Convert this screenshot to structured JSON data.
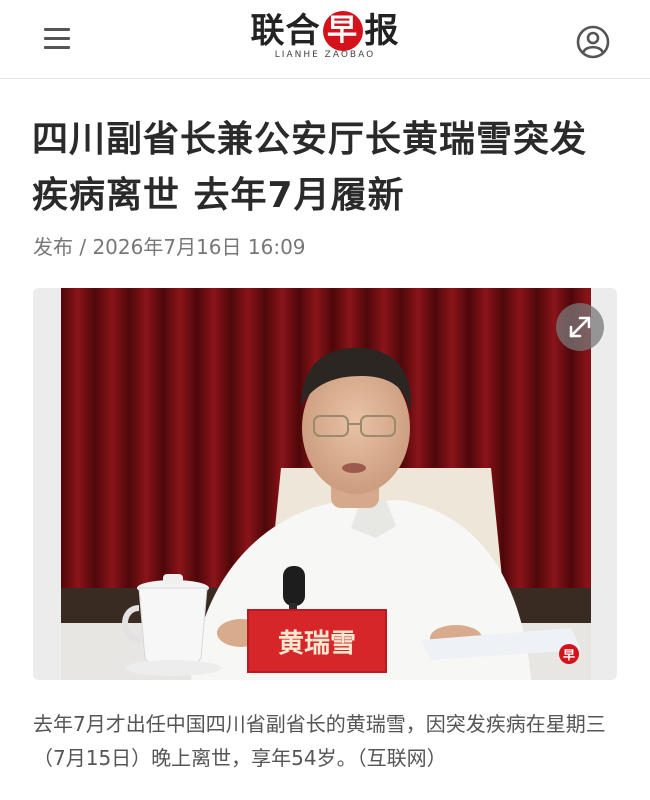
{
  "header": {
    "logo_cn_1": "联合",
    "logo_cn_2": "早",
    "logo_cn_3": "报",
    "logo_en": "LIANHE ZAOBAO",
    "menu_icon": "hamburger-menu-icon",
    "account_icon": "user-account-icon"
  },
  "article": {
    "title": "四川副省长兼公安厅长黄瑞雪突发疾病离世 去年7月履新",
    "published": "发布 / 2026年7月16日 16:09",
    "image": {
      "nameplate": "黄瑞雪",
      "watermark": "早",
      "expand_icon": "expand-icon"
    },
    "caption": "去年7月才出任中国四川省副省长的黄瑞雪，因突发疾病在星期三（7月15日）晚上离世，享年54岁。（互联网）"
  },
  "colors": {
    "brand_red": "#d4121c",
    "curtain": "#6e0d12",
    "nameplate": "#d6262a"
  }
}
